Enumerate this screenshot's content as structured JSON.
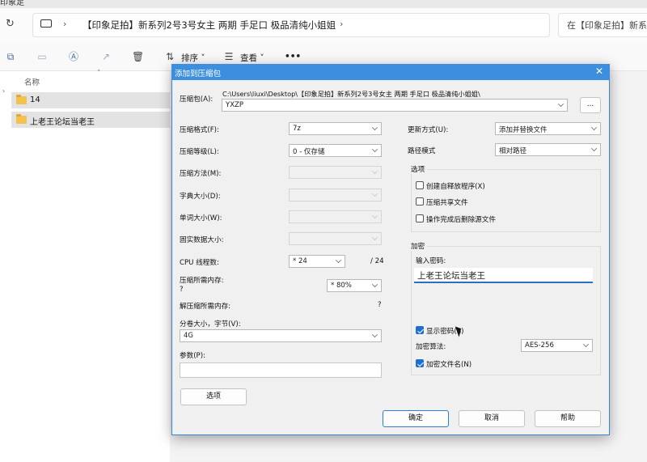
{
  "explorer": {
    "title_fragment": "印象足",
    "path_segment": "【印象足拍】新系列2号3号女主 两期 手足口 极品清纯小姐姐",
    "search_placeholder": "在【印象足拍】新系列",
    "toolbar": {
      "sort_label": "排序",
      "view_label": "查看",
      "more_label": "•••"
    },
    "column_header": "名称",
    "files": [
      {
        "name": "14"
      },
      {
        "name": "上老王论坛当老王"
      }
    ]
  },
  "dialog": {
    "title": "添加到压缩包",
    "archive_label": "压缩包(A):",
    "archive_dir": "C:\\Users\\liuxi\\Desktop\\【印象足拍】新系列2号3号女主 两期 手足口 极品清纯小姐姐\\",
    "archive_name": "YXZP",
    "browse_label": "...",
    "format_label": "压缩格式(F):",
    "format_value": "7z",
    "level_label": "压缩等级(L):",
    "level_value": "0 - 仅存储",
    "method_label": "压缩方法(M):",
    "dict_label": "字典大小(D):",
    "word_label": "单词大小(W):",
    "solid_label": "固实数据大小:",
    "threads_label": "CPU 线程数:",
    "threads_value": "* 24",
    "threads_total": "/ 24",
    "mem_comp_label": "压缩所需内存:",
    "mem_comp_q": "?",
    "mem_comp_value": "* 80%",
    "mem_decomp_label": "解压缩所需内存:",
    "mem_decomp_q": "?",
    "volume_label": "分卷大小，字节(V):",
    "volume_value": "4G",
    "params_label": "参数(P):",
    "options_btn": "选项",
    "update_label": "更新方式(U):",
    "update_value": "添加并替换文件",
    "pathmode_label": "路径模式",
    "pathmode_value": "相对路径",
    "options_group": "选项",
    "opt_sfx": "创建自释放程序(X)",
    "opt_shared": "压缩共享文件",
    "opt_delete": "操作完成后删除源文件",
    "encrypt_group": "加密",
    "password_label": "输入密码:",
    "password_value": "上老王论坛当老王",
    "show_password": "显示密码(S)",
    "enc_method_label": "加密算法:",
    "enc_method_value": "AES-256",
    "encrypt_names": "加密文件名(N)",
    "ok": "确定",
    "cancel": "取消",
    "help": "帮助"
  }
}
